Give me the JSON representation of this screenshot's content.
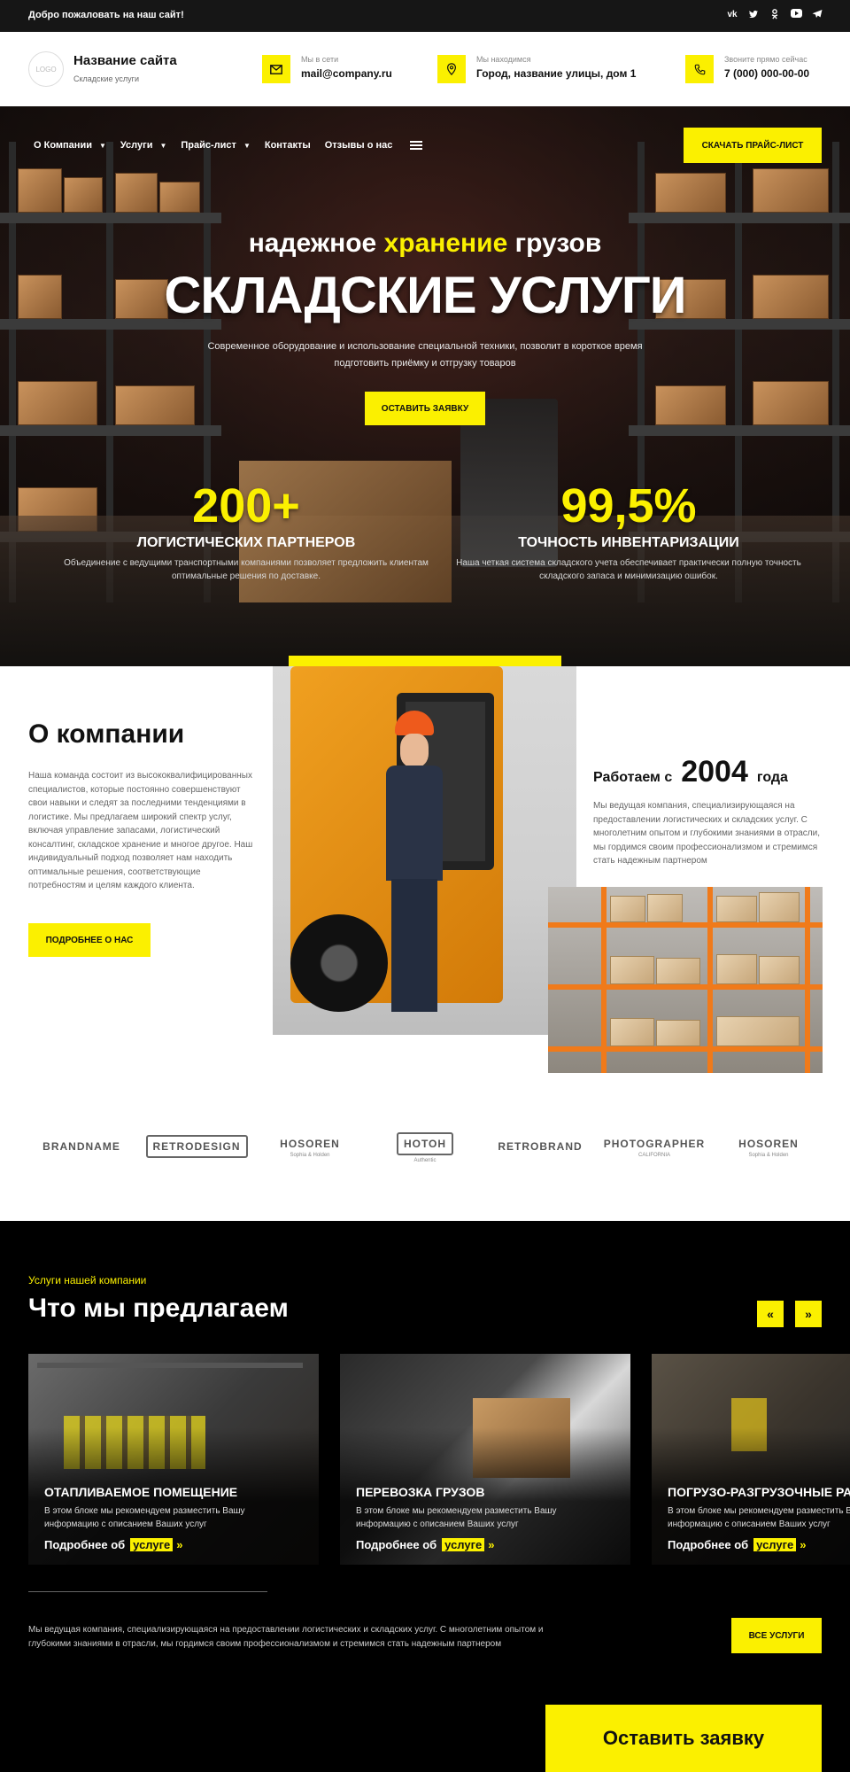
{
  "topbar": {
    "welcome": "Добро пожаловать на наш сайт!",
    "socials": [
      {
        "icon": "vk-icon",
        "glyph": "vk"
      },
      {
        "icon": "twitter-icon",
        "glyph": "t"
      },
      {
        "icon": "odnoklassniki-icon",
        "glyph": "ok"
      },
      {
        "icon": "youtube-icon",
        "glyph": "▶"
      },
      {
        "icon": "telegram-icon",
        "glyph": "➤"
      }
    ]
  },
  "header": {
    "logo": "LOGO",
    "site_name": "Название сайта",
    "site_sub": "Складские услуги",
    "email_label": "Мы в сети",
    "email": "mail@company.ru",
    "address_label": "Мы находимся",
    "address": "Город, название улицы, дом 1",
    "phone_label": "Звоните прямо сейчас",
    "phone": "7 (000) 000-00-00"
  },
  "nav": {
    "items": [
      "О Компании",
      "Услуги",
      "Прайс-лист",
      "Контакты",
      "Отзывы о нас"
    ],
    "download_button": "Скачать прайс-лист"
  },
  "hero": {
    "sub_pre": "надежное ",
    "sub_highlight": "хранение",
    "sub_post": " грузов",
    "title": "СКЛАДСКИЕ УСЛУГИ",
    "desc": "Современное оборудование и использование специальной техники, позволит в короткое время подготовить приёмку и отгрузку товаров",
    "cta": "Оставить заявку",
    "stats": [
      {
        "num": "200+",
        "label": "ЛОГИСТИЧЕСКИХ ПАРТНЕРОВ",
        "text": "Объединение с ведущими транспортными компаниями позволяет предложить клиентам оптимальные решения по доставке."
      },
      {
        "num": "99,5%",
        "label": "ТОЧНОСТЬ ИНВЕНТАРИЗАЦИИ",
        "text": "Наша четкая система складского учета обеспечивает практически полную точность складского запаса и минимизацию ошибок."
      }
    ]
  },
  "about": {
    "title": "О компании",
    "text": "Наша команда состоит из высококвалифицированных специалистов, которые постоянно совершенствуют свои навыки и следят за последними тенденциями в логистике. Мы предлагаем широкий спектр услуг, включая управление запасами, логистический консалтинг, складское хранение и многое другое. Наш индивидуальный подход позволяет нам находить оптимальные решения, соответствующие потребностям и целям каждого клиента.",
    "button": "Подробнее о нас",
    "since_pre": "Работаем с",
    "since_year": "2004",
    "since_post": "года",
    "since_text": "Мы ведущая компания, специализирующаяся на предоставлении логистических и складских услуг. С многолетним опытом и глубокими знаниями в отрасли, мы гордимся своим профессионализмом и стремимся стать надежным партнером"
  },
  "brands": [
    {
      "name": "BRANDNAME",
      "sub": "",
      "boxed": false
    },
    {
      "name": "RETRODESIGN",
      "sub": "",
      "boxed": true
    },
    {
      "name": "HOSOREN",
      "sub": "Sophia & Holden",
      "boxed": false
    },
    {
      "name": "HOTOH",
      "sub": "Authentic",
      "boxed": true
    },
    {
      "name": "RETROBRAND",
      "sub": "",
      "boxed": false
    },
    {
      "name": "PHOTOGRAPHER",
      "sub": "CALIFORNIA",
      "boxed": false
    },
    {
      "name": "HOSOREN",
      "sub": "Sophia & Holden",
      "boxed": false
    }
  ],
  "services": {
    "kicker": "Услуги нашей компании",
    "title": "Что мы предлагаем",
    "prev": "«",
    "next": "»",
    "cards": [
      {
        "title": "ОТАПЛИВАЕМОЕ ПОМЕЩЕНИЕ",
        "text": "В этом блоке мы рекомендуем разместить Вашу информацию с описанием Ваших услуг",
        "more": "Подробнее об",
        "more_hl": "услуге",
        "arrow": "»"
      },
      {
        "title": "ПЕРЕВОЗКА ГРУЗОВ",
        "text": "В этом блоке мы рекомендуем разместить Вашу информацию с описанием Ваших услуг",
        "more": "Подробнее об",
        "more_hl": "услуге",
        "arrow": "»"
      },
      {
        "title": "ПОГРУЗО-РАЗГРУЗОЧНЫЕ РА",
        "text": "В этом блоке мы рекомендуем разместить Вашу информацию с описанием Ваших услуг",
        "more": "Подробнее об",
        "more_hl": "услуге",
        "arrow": "»"
      }
    ],
    "desc": "Мы ведущая компания, специализирующаяся на предоставлении логистических и складских услуг. С многолетним опытом и глубокими знаниями в отрасли, мы гордимся своим профессионализмом и стремимся стать надежным партнером",
    "all_button": "Все услуги",
    "order_button": "Оставить заявку"
  },
  "colors": {
    "accent": "#fbf000",
    "dark": "#000000",
    "topbar": "#161616"
  }
}
